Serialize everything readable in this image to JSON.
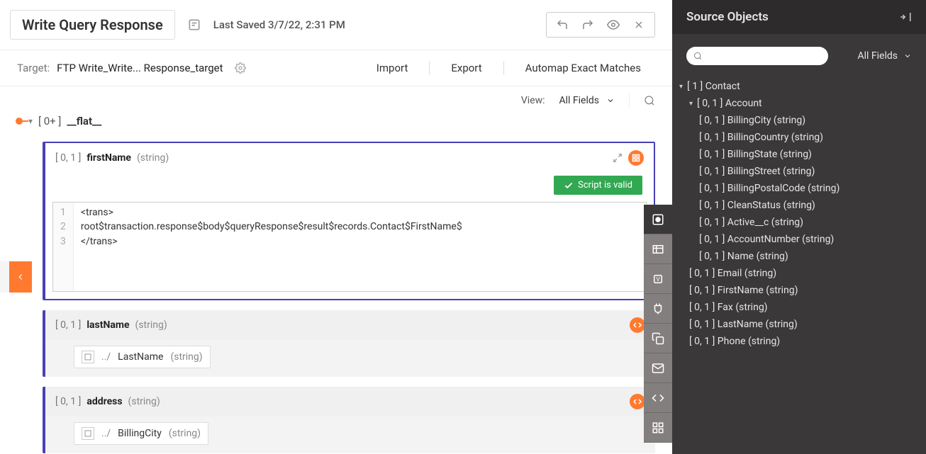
{
  "header": {
    "title": "Write Query Response",
    "last_saved": "Last Saved 3/7/22, 2:31 PM"
  },
  "subheader": {
    "target_label": "Target:",
    "target_value": "FTP Write_Write... Response_target",
    "import": "Import",
    "export": "Export",
    "automap": "Automap Exact Matches"
  },
  "view": {
    "label": "View:",
    "selected": "All Fields"
  },
  "root": {
    "cardinality": "[ 0+ ]",
    "name": "__flat__"
  },
  "firstName": {
    "cardinality": "[ 0, 1 ]",
    "name": "firstName",
    "type": "(string)",
    "valid": "Script is valid",
    "code_l1": "<trans>",
    "code_l2": "root$transaction.response$body$queryResponse$result$records.Contact$FirstName$",
    "code_l3": "</trans>"
  },
  "lastName": {
    "cardinality": "[ 0, 1 ]",
    "name": "lastName",
    "type": "(string)",
    "map_path": "../",
    "map_name": "LastName",
    "map_type": "(string)"
  },
  "address": {
    "cardinality": "[ 0, 1 ]",
    "name": "address",
    "type": "(string)",
    "map_path": "../",
    "map_name": "BillingCity",
    "map_type": "(string)"
  },
  "panel": {
    "title": "Source Objects",
    "allfields": "All Fields",
    "tree": {
      "contact": "[ 1 ] Contact",
      "account": "[ 0, 1 ] Account",
      "billingCity": "[ 0, 1 ] BillingCity (string)",
      "billingCountry": "[ 0, 1 ] BillingCountry (string)",
      "billingState": "[ 0, 1 ] BillingState (string)",
      "billingStreet": "[ 0, 1 ] BillingStreet (string)",
      "billingPostalCode": "[ 0, 1 ] BillingPostalCode (string)",
      "cleanStatus": "[ 0, 1 ] CleanStatus (string)",
      "activeC": "[ 0, 1 ] Active__c (string)",
      "accountNumber": "[ 0, 1 ] AccountNumber (string)",
      "nameF": "[ 0, 1 ] Name (string)",
      "email": "[ 0, 1 ] Email (string)",
      "firstName": "[ 0, 1 ] FirstName (string)",
      "fax": "[ 0, 1 ] Fax (string)",
      "lastName": "[ 0, 1 ] LastName (string)",
      "phone": "[ 0, 1 ] Phone (string)"
    }
  }
}
